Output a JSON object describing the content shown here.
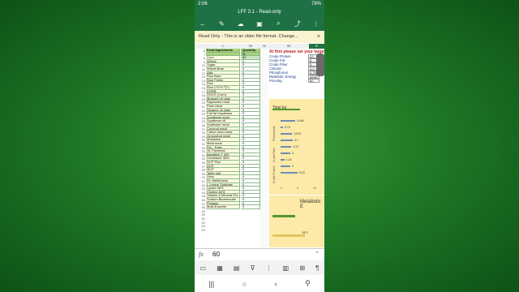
{
  "status": {
    "time": "2:06",
    "battery": "78%"
  },
  "app": {
    "title": "LFF 3.1 - Read-only"
  },
  "toolbar": {
    "back": "←",
    "pen": "✎",
    "cloud": "☁",
    "save": "▣",
    "search": "⌕",
    "share": "⤴",
    "more": "⋮"
  },
  "banner": {
    "text": "Read Only - This is an older file format. Change...",
    "close": "×"
  },
  "columns": {
    "l": "L",
    "m": "M",
    "n": "N",
    "w": "W",
    "x": "X"
  },
  "sheet": {
    "row_numbers": [
      "6",
      "7",
      "8",
      "9",
      "10",
      "11",
      "12",
      "13",
      "14",
      "15",
      "16",
      "17",
      "18",
      "19",
      "20",
      "21",
      "22",
      "23",
      "24",
      "25",
      "26",
      "27",
      "28",
      "29",
      "30",
      "31",
      "32",
      "33",
      "34",
      "35",
      "36",
      "37",
      "38",
      "39",
      "40",
      "41",
      "42",
      "43",
      "44",
      "45",
      "46",
      "47",
      "48",
      "49",
      "50",
      "51",
      "52",
      "53",
      "54"
    ],
    "feed_header": "Feed Ingredients",
    "qty_header": "Quantity",
    "qty_unit": "%",
    "rows": [
      {
        "name": "Corn",
        "qty": "60"
      },
      {
        "name": "Wheat",
        "qty": "0"
      },
      {
        "name": "Sugar",
        "qty": "0"
      },
      {
        "name": "Wheat Bran",
        "qty": "0"
      },
      {
        "name": "Atta",
        "qty": "0"
      },
      {
        "name": "Rice Bran",
        "qty": "0"
      },
      {
        "name": "Rice Polish",
        "qty": "0"
      },
      {
        "name": "Rice",
        "qty": "0"
      },
      {
        "name": "Rice (চালের খুদ)",
        "qty": "0"
      },
      {
        "name": "DORB",
        "qty": "0"
      },
      {
        "name": "DDGS (Corn)",
        "qty": "0"
      },
      {
        "name": "Mustard oil cake",
        "qty": "0"
      },
      {
        "name": "Rapeseed meal",
        "qty": "0"
      },
      {
        "name": "Palm Meal",
        "qty": "0"
      },
      {
        "name": "Sesame oil cake",
        "qty": "0"
      },
      {
        "name": "Full fat Soyabean",
        "qty": "0"
      },
      {
        "name": "Soyabean meal",
        "qty": "0"
      },
      {
        "name": "Soyabean oil",
        "qty": "0"
      },
      {
        "name": "Sunflower meal",
        "qty": "0"
      },
      {
        "name": "Coconut meal",
        "qty": "0"
      },
      {
        "name": "Cotton seed meal",
        "qty": "0"
      },
      {
        "name": "Groundnut meal",
        "qty": "0"
      },
      {
        "name": "Molasses",
        "qty": "0"
      },
      {
        "name": "Meat meal",
        "qty": "0"
      },
      {
        "name": "Pro - Pack",
        "qty": "0"
      },
      {
        "name": "GL Fishmeal",
        "qty": "0"
      },
      {
        "name": "Banalfish T 300",
        "qty": "0"
      },
      {
        "name": "Limestone 36%",
        "qty": "0"
      },
      {
        "name": "DCP Plus",
        "qty": "0"
      },
      {
        "name": "DCP",
        "qty": "0"
      },
      {
        "name": "MCP",
        "qty": "0"
      },
      {
        "name": "Table salt",
        "qty": "0"
      },
      {
        "name": "Urea",
        "qty": "0"
      },
      {
        "name": "DL-Methionine",
        "qty": "0"
      },
      {
        "name": "L-Lysine Sulphate",
        "qty": "0"
      },
      {
        "name": "Lysine 55%",
        "qty": "0"
      },
      {
        "name": "Choline 60%",
        "qty": "0"
      },
      {
        "name": "Vitamin & Mineral Pre",
        "qty": "0"
      },
      {
        "name": "Sodium Bicarbonate",
        "qty": "0"
      },
      {
        "name": "Phytase",
        "qty": "0"
      },
      {
        "name": "Multi-Enzyme",
        "qty": "0"
      }
    ]
  },
  "target_panel": {
    "title": "At first please set your target:",
    "items": [
      {
        "label": "Crude Protein",
        "value": "22"
      },
      {
        "label": "Crude Fat",
        "value": "6"
      },
      {
        "label": "Crude Fiber",
        "value": "5"
      },
      {
        "label": "Calcium",
        "value": "1.2"
      },
      {
        "label": "Phosphorus",
        "value": "0.75"
      },
      {
        "label": "Metabolic Energy",
        "value": "3200"
      },
      {
        "label": "Price/kg",
        "value": "60"
      }
    ]
  },
  "chart_a": {
    "title": "Total kg",
    "bar_labels": [
      "4.464",
      "0.74",
      "3.612",
      "3.7",
      "3.31",
      "3",
      "1.16",
      "3",
      "5.18"
    ],
    "y_axis_labels": [
      "Phosphorus",
      "Crude Fiber",
      "Crude Protein"
    ],
    "x_ticks": [
      "0",
      "5",
      "10"
    ]
  },
  "chart_b": {
    "title": "Metabolic E",
    "value": "1871"
  },
  "formula_bar": {
    "fx": "fx",
    "value": "60",
    "collapse": "⌃"
  },
  "ribbon": {
    "i1": "▭",
    "i2": "▦",
    "i3": "▤",
    "i4": "⊽",
    "i5": "⋮",
    "i6": "▥",
    "i7": "⊞",
    "i8": "¶"
  },
  "navbar": {
    "recent": "|||",
    "home": "○",
    "back": "‹",
    "access": "⚲"
  }
}
